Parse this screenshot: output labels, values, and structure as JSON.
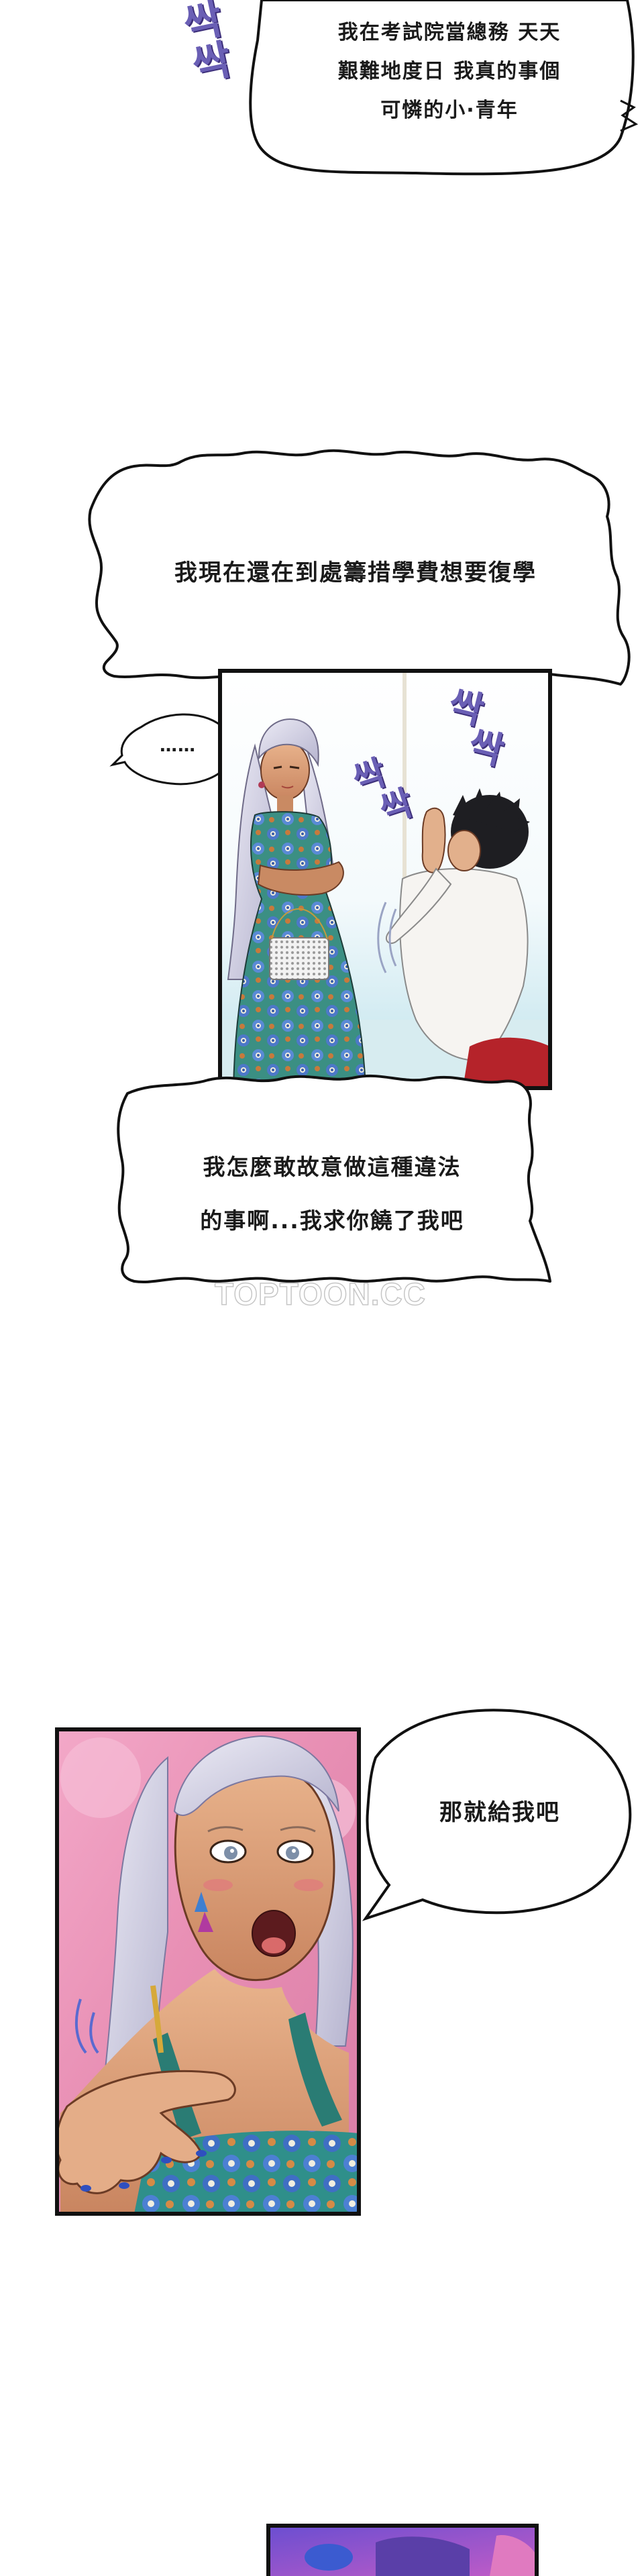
{
  "bubbles": {
    "b1": "我在考試院當總務 天天\n艱難地度日 我真的事個\n可憐的小·青年",
    "b2": "我現在還在到處籌措學費想要復學",
    "b3": "……",
    "b4": "我怎麼敢故意做這種違法\n的事啊...我求你饒了我吧",
    "b5": "那就給我吧"
  },
  "sfx": {
    "s1": "싹싹",
    "s2a": "싹",
    "s2b": "싹",
    "s3a": "싹",
    "s3b": "싹"
  },
  "watermark": "TOPTOON.CC",
  "colors": {
    "sfx": "#6a5fb5",
    "panel_border": "#111111",
    "sky": "#e8f4f8"
  }
}
